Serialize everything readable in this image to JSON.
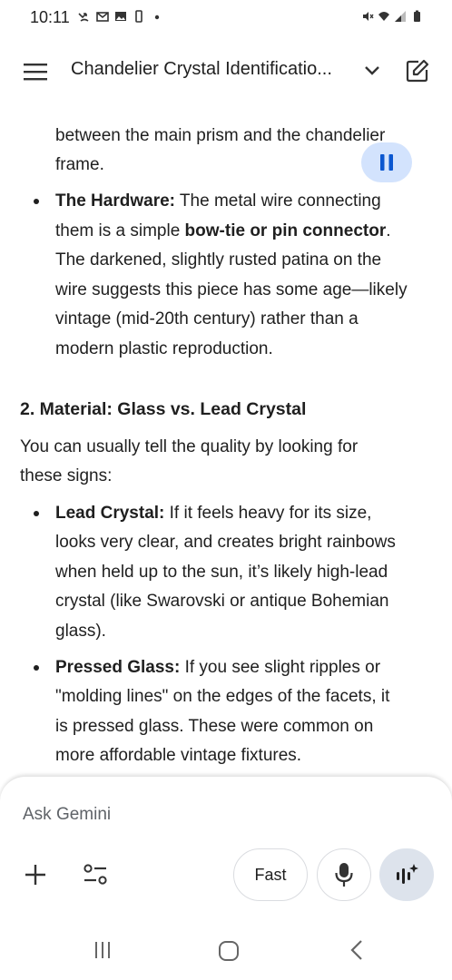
{
  "status_bar": {
    "time": "10:11",
    "left_icons": [
      "missed-call-icon",
      "gmail-icon",
      "image-icon",
      "phone-icon",
      "dot-icon"
    ],
    "right_icons": [
      "mute-icon",
      "wifi-icon",
      "signal-icon",
      "battery-icon"
    ]
  },
  "header": {
    "title": "Chandelier Crystal Identificatio..."
  },
  "content": {
    "partial_line_1": "between the main prism and the chandelier",
    "partial_line_2": "frame.",
    "hardware": {
      "label": "The Hardware:",
      "line1_rest": " The metal wire connecting",
      "line2_start": "them is a simple ",
      "line2_bold": "bow-tie or pin connector",
      "line2_end": ".",
      "line3": "The darkened, slightly rusted patina on the",
      "line4": "wire suggests this piece has some age—likely",
      "line5": "vintage (mid-20th century) rather than a",
      "line6": "modern plastic reproduction."
    },
    "section_heading": "2. Material: Glass vs. Lead Crystal",
    "intro_line1": "You can usually tell the quality by looking for",
    "intro_line2": "these signs:",
    "lead_crystal": {
      "label": "Lead Crystal:",
      "line1_rest": " If it feels heavy for its size,",
      "line2": "looks very clear, and creates bright rainbows",
      "line3": "when held up to the sun, it’s likely high-lead",
      "line4": "crystal (like Swarovski or antique Bohemian",
      "line5": "glass)."
    },
    "pressed_glass": {
      "label": "Pressed Glass:",
      "line1_rest": " If you see slight ripples or",
      "line2": "\"molding lines\" on the edges of the facets, it",
      "line3": "is pressed glass. These were common on",
      "line4": "more affordable vintage fixtures."
    }
  },
  "input": {
    "placeholder": "Ask Gemini",
    "fast_label": "Fast"
  },
  "colors": {
    "pause_bg": "#d3e3fd",
    "pause_icon": "#0b57d0",
    "live_bg": "#dde3ec"
  }
}
